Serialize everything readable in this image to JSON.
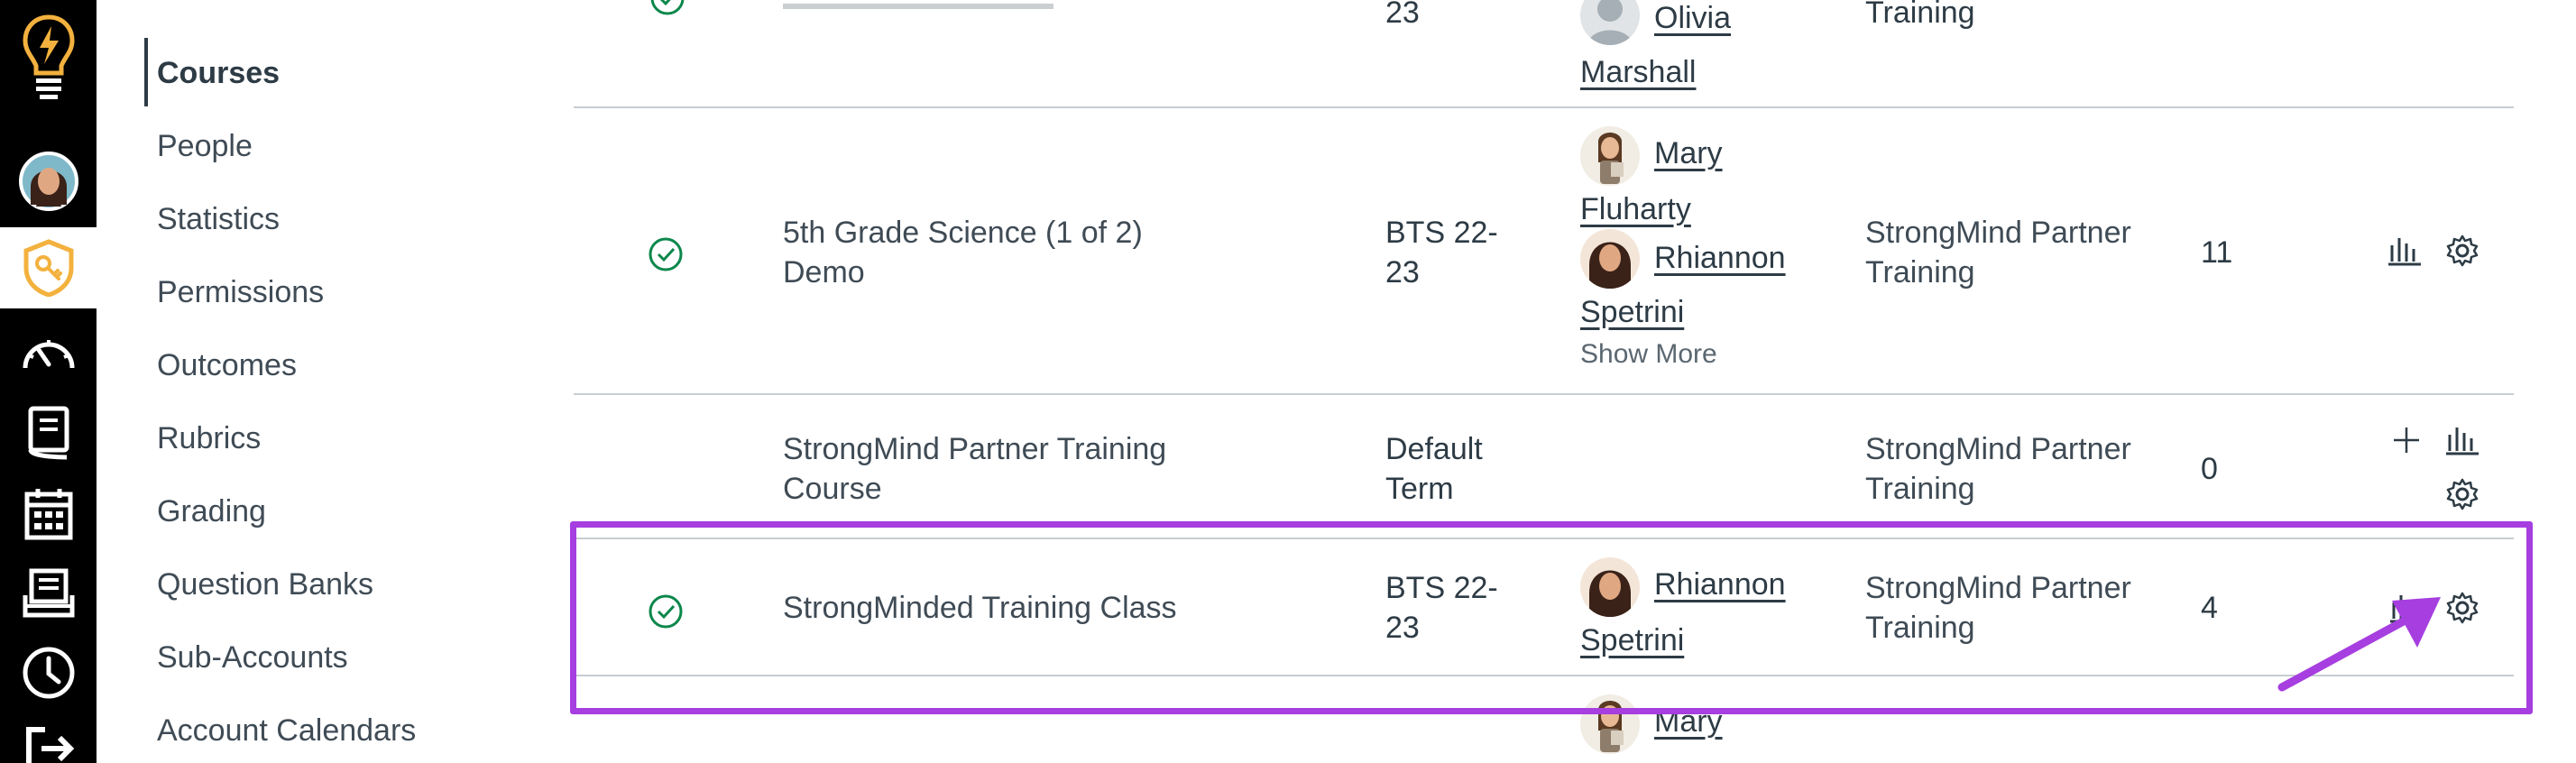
{
  "global_nav": {
    "items": [
      {
        "name": "logo",
        "icon": "lightbulb-logo-icon"
      },
      {
        "name": "account",
        "icon": "user-avatar-icon"
      },
      {
        "name": "admin",
        "icon": "shield-key-icon"
      },
      {
        "name": "dashboard",
        "icon": "speedometer-icon"
      },
      {
        "name": "courses",
        "icon": "book-icon"
      },
      {
        "name": "calendar",
        "icon": "calendar-icon"
      },
      {
        "name": "inbox",
        "icon": "inbox-icon"
      },
      {
        "name": "history",
        "icon": "clock-icon"
      },
      {
        "name": "help",
        "icon": "logout-arrow-icon"
      }
    ],
    "colors": {
      "background": "#000000",
      "active_icon": "#f3b13e",
      "icon": "#ffffff"
    }
  },
  "account_nav": {
    "items": [
      {
        "label": "Courses",
        "active": true
      },
      {
        "label": "People"
      },
      {
        "label": "Statistics"
      },
      {
        "label": "Permissions"
      },
      {
        "label": "Outcomes"
      },
      {
        "label": "Rubrics"
      },
      {
        "label": "Grading"
      },
      {
        "label": "Question Banks"
      },
      {
        "label": "Sub-Accounts"
      },
      {
        "label": "Account Calendars"
      }
    ]
  },
  "courses_table": {
    "partial_top_row": {
      "term": "23",
      "teachers": [
        {
          "first": "Olivia",
          "last": "Marshall"
        }
      ],
      "sub_account": "Training"
    },
    "rows": [
      {
        "published": true,
        "course": [
          "5th Grade Science (1 of 2)",
          "Demo"
        ],
        "term": [
          "BTS 22-",
          "23"
        ],
        "teachers": [
          {
            "first": "Mary",
            "last": "Fluharty"
          },
          {
            "first": "Rhiannon",
            "last": "Spetrini"
          }
        ],
        "show_more": "Show More",
        "sub_account": [
          "StrongMind Partner",
          "Training"
        ],
        "students": "11"
      },
      {
        "published": false,
        "course": [
          "StrongMind Partner Training",
          "Course"
        ],
        "term": [
          "Default",
          "Term"
        ],
        "teachers": [],
        "sub_account": [
          "StrongMind Partner",
          "Training"
        ],
        "students": "0"
      },
      {
        "published": true,
        "course": [
          "StrongMinded Training Class"
        ],
        "term": [
          "BTS 22-",
          "23"
        ],
        "teachers": [
          {
            "first": "Rhiannon",
            "last": "Spetrini"
          }
        ],
        "sub_account": [
          "StrongMind Partner",
          "Training"
        ],
        "students": "4"
      }
    ],
    "partial_bottom_row": {
      "teachers": [
        {
          "first": "Mary"
        }
      ]
    }
  },
  "annotation": {
    "color": "#a63ee0"
  },
  "colors": {
    "published_green": "#0b874b",
    "divider": "#c7cdd1",
    "text": "#2d3b45"
  }
}
